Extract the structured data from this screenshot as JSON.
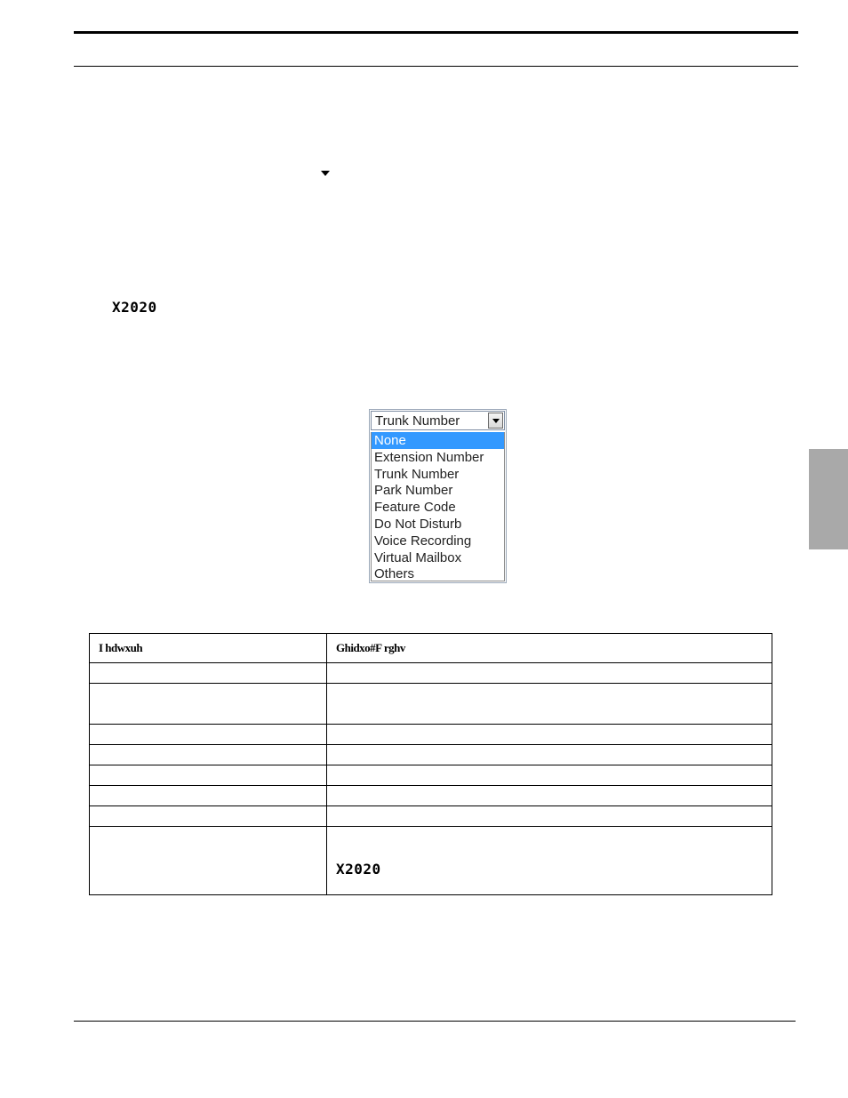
{
  "document": {
    "code_label_1": "X2020",
    "side_tab_color": "#a9a9a9"
  },
  "dropdown": {
    "current_value": "Trunk Number",
    "options": [
      "None",
      "Extension Number",
      "Trunk Number",
      "Park Number",
      "Feature Code",
      "Do Not Disturb",
      "Voice Recording",
      "Virtual Mailbox",
      "Others"
    ],
    "highlighted_index": 0,
    "highlight_color": "#3399ff"
  },
  "table": {
    "headers": [
      "I hdwxuh",
      "Ghidxo#F rghv"
    ],
    "rows": [
      [
        "",
        ""
      ],
      [
        "",
        ""
      ],
      [
        "",
        ""
      ],
      [
        "",
        ""
      ],
      [
        "",
        ""
      ],
      [
        "",
        ""
      ],
      [
        "",
        ""
      ],
      [
        "",
        "X2020"
      ]
    ]
  }
}
